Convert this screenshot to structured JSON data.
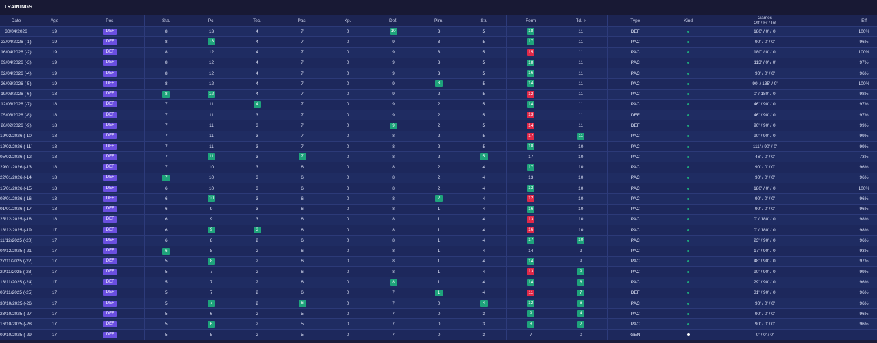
{
  "title": "TRAININGS",
  "columns": {
    "date": "Date",
    "age": "Age",
    "pos": "Pos.",
    "sta": "Sta.",
    "pc": "Pc.",
    "tec": "Tec.",
    "pas": "Pas.",
    "kp": "Kp.",
    "def": "Def.",
    "plm": "Plm.",
    "str": "Str.",
    "form": "Form",
    "td": "Td.",
    "type": "Type",
    "kind": "Kind",
    "games_line1": "Games",
    "games_line2": "Off / Fr / Int",
    "eff": "Eff"
  },
  "colors": {
    "green": "#1ea37b",
    "red": "#e02848",
    "pos": "#6a4fe0"
  },
  "rows": [
    {
      "date": "30/04/2026",
      "age": "19",
      "pos": "DEF",
      "sta": "8",
      "pc": "13",
      "tec": "4",
      "pas": "7",
      "kp": "0",
      "def": "10",
      "plm": "3",
      "str": "5",
      "form": "18",
      "td": "11",
      "type": "DEF",
      "kind": "dot",
      "games": "180' / 0' / 0'",
      "eff": "100%",
      "hl": {
        "def": "green",
        "form": "green"
      }
    },
    {
      "date": "23/04/2026 (-1)",
      "age": "19",
      "pos": "DEF",
      "sta": "8",
      "pc": "13",
      "tec": "4",
      "pas": "7",
      "kp": "0",
      "def": "9",
      "plm": "3",
      "str": "5",
      "form": "17",
      "td": "11",
      "type": "PAC",
      "kind": "dot",
      "games": "90' / 0' / 0'",
      "eff": "96%",
      "hl": {
        "pc": "green",
        "form": "green"
      }
    },
    {
      "date": "16/04/2026 (-2)",
      "age": "19",
      "pos": "DEF",
      "sta": "8",
      "pc": "12",
      "tec": "4",
      "pas": "7",
      "kp": "0",
      "def": "9",
      "plm": "3",
      "str": "5",
      "form": "15",
      "td": "11",
      "type": "PAC",
      "kind": "dot",
      "games": "180' / 0' / 0'",
      "eff": "100%",
      "hl": {
        "form": "red"
      }
    },
    {
      "date": "09/04/2026 (-3)",
      "age": "19",
      "pos": "DEF",
      "sta": "8",
      "pc": "12",
      "tec": "4",
      "pas": "7",
      "kp": "0",
      "def": "9",
      "plm": "3",
      "str": "5",
      "form": "18",
      "td": "11",
      "type": "PAC",
      "kind": "dot",
      "games": "113' / 0' / 0'",
      "eff": "97%",
      "hl": {
        "form": "green"
      }
    },
    {
      "date": "02/04/2026 (-4)",
      "age": "19",
      "pos": "DEF",
      "sta": "8",
      "pc": "12",
      "tec": "4",
      "pas": "7",
      "kp": "0",
      "def": "9",
      "plm": "3",
      "str": "5",
      "form": "16",
      "td": "11",
      "type": "PAC",
      "kind": "dot",
      "games": "90' / 0' / 0'",
      "eff": "96%",
      "hl": {
        "form": "green"
      }
    },
    {
      "date": "26/03/2026 (-5)",
      "age": "19",
      "pos": "DEF",
      "sta": "8",
      "pc": "12",
      "tec": "4",
      "pas": "7",
      "kp": "0",
      "def": "9",
      "plm": "3",
      "str": "5",
      "form": "14",
      "td": "11",
      "type": "PAC",
      "kind": "dot",
      "games": "90' / 135' / 0'",
      "eff": "100%",
      "hl": {
        "plm": "green",
        "form": "green"
      }
    },
    {
      "date": "19/03/2026 (-6)",
      "age": "18",
      "pos": "DEF",
      "sta": "8",
      "pc": "12",
      "tec": "4",
      "pas": "7",
      "kp": "0",
      "def": "9",
      "plm": "2",
      "str": "5",
      "form": "12",
      "td": "11",
      "type": "PAC",
      "kind": "dot",
      "games": "0' / 180' / 0'",
      "eff": "98%",
      "hl": {
        "sta": "green",
        "pc": "green",
        "form": "red"
      }
    },
    {
      "date": "12/03/2026 (-7)",
      "age": "18",
      "pos": "DEF",
      "sta": "7",
      "pc": "11",
      "tec": "4",
      "pas": "7",
      "kp": "0",
      "def": "9",
      "plm": "2",
      "str": "5",
      "form": "14",
      "td": "11",
      "type": "PAC",
      "kind": "dot",
      "games": "46' / 90' / 0'",
      "eff": "97%",
      "hl": {
        "tec": "green",
        "form": "green"
      }
    },
    {
      "date": "05/03/2026 (-8)",
      "age": "18",
      "pos": "DEF",
      "sta": "7",
      "pc": "11",
      "tec": "3",
      "pas": "7",
      "kp": "0",
      "def": "9",
      "plm": "2",
      "str": "5",
      "form": "13",
      "td": "11",
      "type": "DEF",
      "kind": "dot",
      "games": "46' / 90' / 0'",
      "eff": "97%",
      "hl": {
        "form": "red"
      }
    },
    {
      "date": "26/02/2026 (-9)",
      "age": "18",
      "pos": "DEF",
      "sta": "7",
      "pc": "11",
      "tec": "3",
      "pas": "7",
      "kp": "0",
      "def": "9",
      "plm": "2",
      "str": "5",
      "form": "14",
      "td": "11",
      "type": "DEF",
      "kind": "dot",
      "games": "90' / 90' / 0'",
      "eff": "99%",
      "hl": {
        "def": "green",
        "form": "red"
      }
    },
    {
      "date": "19/02/2026 (-10)",
      "age": "18",
      "pos": "DEF",
      "sta": "7",
      "pc": "11",
      "tec": "3",
      "pas": "7",
      "kp": "0",
      "def": "8",
      "plm": "2",
      "str": "5",
      "form": "17",
      "td": "11",
      "type": "PAC",
      "kind": "dot",
      "games": "90' / 90' / 0'",
      "eff": "99%",
      "hl": {
        "form": "red",
        "td": "green"
      }
    },
    {
      "date": "12/02/2026 (-11)",
      "age": "18",
      "pos": "DEF",
      "sta": "7",
      "pc": "11",
      "tec": "3",
      "pas": "7",
      "kp": "0",
      "def": "8",
      "plm": "2",
      "str": "5",
      "form": "18",
      "td": "10",
      "type": "PAC",
      "kind": "dot",
      "games": "111' / 90' / 0'",
      "eff": "99%",
      "hl": {
        "form": "green"
      }
    },
    {
      "date": "05/02/2026 (-12)",
      "age": "18",
      "pos": "DEF",
      "sta": "7",
      "pc": "11",
      "tec": "3",
      "pas": "7",
      "kp": "0",
      "def": "8",
      "plm": "2",
      "str": "5",
      "form": "17",
      "td": "10",
      "type": "PAC",
      "kind": "dot",
      "games": "46' / 0' / 0'",
      "eff": "73%",
      "hl": {
        "pc": "green",
        "pas": "green",
        "str": "green"
      }
    },
    {
      "date": "29/01/2026 (-13)",
      "age": "18",
      "pos": "DEF",
      "sta": "7",
      "pc": "10",
      "tec": "3",
      "pas": "6",
      "kp": "0",
      "def": "8",
      "plm": "2",
      "str": "4",
      "form": "17",
      "td": "10",
      "type": "PAC",
      "kind": "dot",
      "games": "90' / 0' / 0'",
      "eff": "96%",
      "hl": {
        "form": "green"
      }
    },
    {
      "date": "22/01/2026 (-14)",
      "age": "18",
      "pos": "DEF",
      "sta": "7",
      "pc": "10",
      "tec": "3",
      "pas": "6",
      "kp": "0",
      "def": "8",
      "plm": "2",
      "str": "4",
      "form": "13",
      "td": "10",
      "type": "PAC",
      "kind": "dot",
      "games": "90' / 0' / 0'",
      "eff": "96%",
      "hl": {
        "sta": "green"
      }
    },
    {
      "date": "15/01/2026 (-15)",
      "age": "18",
      "pos": "DEF",
      "sta": "6",
      "pc": "10",
      "tec": "3",
      "pas": "6",
      "kp": "0",
      "def": "8",
      "plm": "2",
      "str": "4",
      "form": "13",
      "td": "10",
      "type": "PAC",
      "kind": "dot",
      "games": "180' / 0' / 0'",
      "eff": "100%",
      "hl": {
        "form": "green"
      }
    },
    {
      "date": "08/01/2026 (-16)",
      "age": "18",
      "pos": "DEF",
      "sta": "6",
      "pc": "10",
      "tec": "3",
      "pas": "6",
      "kp": "0",
      "def": "8",
      "plm": "2",
      "str": "4",
      "form": "12",
      "td": "10",
      "type": "PAC",
      "kind": "dot",
      "games": "90' / 0' / 0'",
      "eff": "96%",
      "hl": {
        "pc": "green",
        "plm": "green",
        "form": "red"
      }
    },
    {
      "date": "01/01/2026 (-17)",
      "age": "18",
      "pos": "DEF",
      "sta": "6",
      "pc": "9",
      "tec": "3",
      "pas": "6",
      "kp": "0",
      "def": "8",
      "plm": "1",
      "str": "4",
      "form": "16",
      "td": "10",
      "type": "PAC",
      "kind": "dot",
      "games": "90' / 0' / 0'",
      "eff": "96%",
      "hl": {
        "form": "green"
      }
    },
    {
      "date": "25/12/2025 (-18)",
      "age": "18",
      "pos": "DEF",
      "sta": "6",
      "pc": "9",
      "tec": "3",
      "pas": "6",
      "kp": "0",
      "def": "8",
      "plm": "1",
      "str": "4",
      "form": "13",
      "td": "10",
      "type": "PAC",
      "kind": "dot",
      "games": "0' / 180' / 0'",
      "eff": "98%",
      "hl": {
        "form": "red"
      }
    },
    {
      "date": "18/12/2025 (-19)",
      "age": "17",
      "pos": "DEF",
      "sta": "6",
      "pc": "9",
      "tec": "3",
      "pas": "6",
      "kp": "0",
      "def": "8",
      "plm": "1",
      "str": "4",
      "form": "16",
      "td": "10",
      "type": "PAC",
      "kind": "dot",
      "games": "0' / 180' / 0'",
      "eff": "98%",
      "hl": {
        "pc": "green",
        "tec": "green",
        "form": "red"
      }
    },
    {
      "date": "11/12/2025 (-20)",
      "age": "17",
      "pos": "DEF",
      "sta": "6",
      "pc": "8",
      "tec": "2",
      "pas": "6",
      "kp": "0",
      "def": "8",
      "plm": "1",
      "str": "4",
      "form": "17",
      "td": "10",
      "type": "PAC",
      "kind": "dot",
      "games": "23' / 90' / 0'",
      "eff": "96%",
      "hl": {
        "form": "green",
        "td": "green"
      }
    },
    {
      "date": "04/12/2025 (-21)",
      "age": "17",
      "pos": "DEF",
      "sta": "6",
      "pc": "8",
      "tec": "2",
      "pas": "6",
      "kp": "0",
      "def": "8",
      "plm": "1",
      "str": "4",
      "form": "14",
      "td": "9",
      "type": "PAC",
      "kind": "dot",
      "games": "17' / 90' / 0'",
      "eff": "93%",
      "hl": {
        "sta": "green"
      }
    },
    {
      "date": "27/11/2025 (-22)",
      "age": "17",
      "pos": "DEF",
      "sta": "5",
      "pc": "8",
      "tec": "2",
      "pas": "6",
      "kp": "0",
      "def": "8",
      "plm": "1",
      "str": "4",
      "form": "14",
      "td": "9",
      "type": "PAC",
      "kind": "dot",
      "games": "48' / 90' / 0'",
      "eff": "97%",
      "hl": {
        "pc": "green",
        "form": "green"
      }
    },
    {
      "date": "20/11/2025 (-23)",
      "age": "17",
      "pos": "DEF",
      "sta": "5",
      "pc": "7",
      "tec": "2",
      "pas": "6",
      "kp": "0",
      "def": "8",
      "plm": "1",
      "str": "4",
      "form": "13",
      "td": "9",
      "type": "PAC",
      "kind": "dot",
      "games": "90' / 90' / 0'",
      "eff": "99%",
      "hl": {
        "form": "red",
        "td": "green"
      }
    },
    {
      "date": "13/11/2025 (-24)",
      "age": "17",
      "pos": "DEF",
      "sta": "5",
      "pc": "7",
      "tec": "2",
      "pas": "6",
      "kp": "0",
      "def": "8",
      "plm": "1",
      "str": "4",
      "form": "14",
      "td": "8",
      "type": "PAC",
      "kind": "dot",
      "games": "29' / 90' / 0'",
      "eff": "96%",
      "hl": {
        "def": "green",
        "form": "green",
        "td": "green"
      }
    },
    {
      "date": "06/11/2025 (-25)",
      "age": "17",
      "pos": "DEF",
      "sta": "5",
      "pc": "7",
      "tec": "2",
      "pas": "6",
      "kp": "0",
      "def": "7",
      "plm": "1",
      "str": "4",
      "form": "11",
      "td": "7",
      "type": "DEF",
      "kind": "dot",
      "games": "31' / 90' / 0'",
      "eff": "96%",
      "hl": {
        "plm": "green",
        "form": "red",
        "td": "green"
      }
    },
    {
      "date": "30/10/2025 (-26)",
      "age": "17",
      "pos": "DEF",
      "sta": "5",
      "pc": "7",
      "tec": "2",
      "pas": "6",
      "kp": "0",
      "def": "7",
      "plm": "0",
      "str": "4",
      "form": "12",
      "td": "6",
      "type": "PAC",
      "kind": "dot",
      "games": "90' / 0' / 0'",
      "eff": "96%",
      "hl": {
        "pc": "green",
        "pas": "green",
        "str": "green",
        "form": "green",
        "td": "green"
      }
    },
    {
      "date": "23/10/2025 (-27)",
      "age": "17",
      "pos": "DEF",
      "sta": "5",
      "pc": "6",
      "tec": "2",
      "pas": "5",
      "kp": "0",
      "def": "7",
      "plm": "0",
      "str": "3",
      "form": "9",
      "td": "4",
      "type": "PAC",
      "kind": "dot",
      "games": "90' / 0' / 0'",
      "eff": "96%",
      "hl": {
        "form": "green",
        "td": "green"
      }
    },
    {
      "date": "16/10/2025 (-28)",
      "age": "17",
      "pos": "DEF",
      "sta": "5",
      "pc": "6",
      "tec": "2",
      "pas": "5",
      "kp": "0",
      "def": "7",
      "plm": "0",
      "str": "3",
      "form": "8",
      "td": "2",
      "type": "PAC",
      "kind": "dot",
      "games": "90' / 0' / 0'",
      "eff": "96%",
      "hl": {
        "pc": "green",
        "form": "green",
        "td": "green"
      }
    },
    {
      "date": "09/10/2025 (-29)",
      "age": "17",
      "pos": "DEF",
      "sta": "5",
      "pc": "5",
      "tec": "2",
      "pas": "5",
      "kp": "0",
      "def": "7",
      "plm": "0",
      "str": "3",
      "form": "7",
      "td": "0",
      "type": "GEN",
      "kind": "white",
      "games": "0' / 0' / 0'",
      "eff": "-",
      "hl": {}
    }
  ]
}
